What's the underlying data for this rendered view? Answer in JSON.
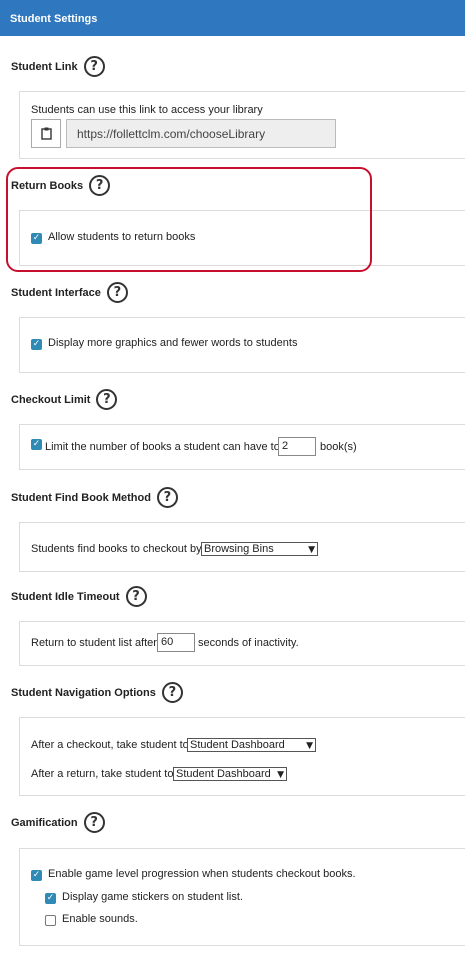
{
  "header": {
    "title": "Student Settings"
  },
  "student_link": {
    "title": "Student Link",
    "description": "Students can use this link to access your library",
    "url": "https://follettclm.com/chooseLibrary"
  },
  "return_books": {
    "title": "Return Books",
    "label": "Allow students to return books",
    "checked": true
  },
  "student_interface": {
    "title": "Student Interface",
    "label": "Display more graphics and fewer words to students",
    "checked": true
  },
  "checkout_limit": {
    "title": "Checkout Limit",
    "label": "Limit the number of books a student can have to",
    "value": "2",
    "suffix": "book(s)",
    "checked": true
  },
  "find_book": {
    "title": "Student Find Book Method",
    "label": "Students find books to checkout by",
    "selected": "Browsing Bins"
  },
  "idle_timeout": {
    "title": "Student Idle Timeout",
    "label": "Return to student list after",
    "value": "60",
    "suffix": "seconds of inactivity."
  },
  "navigation": {
    "title": "Student Navigation Options",
    "after_checkout_label": "After a checkout, take student to",
    "after_checkout_selected": "Student Dashboard",
    "after_return_label": "After a return, take student to",
    "after_return_selected": "Student Dashboard"
  },
  "gamification": {
    "title": "Gamification",
    "progression_label": "Enable game level progression when students checkout books.",
    "progression_checked": true,
    "stickers_label": "Display game stickers on student list.",
    "stickers_checked": true,
    "sounds_label": "Enable sounds.",
    "sounds_checked": false
  },
  "icons": {
    "help": "question-circle-icon",
    "clipboard": "clipboard-icon",
    "check": "checkmark-icon"
  },
  "colors": {
    "header": "#2f78bf",
    "checkbox": "#2f8bb5",
    "highlight": "#c8102e"
  }
}
